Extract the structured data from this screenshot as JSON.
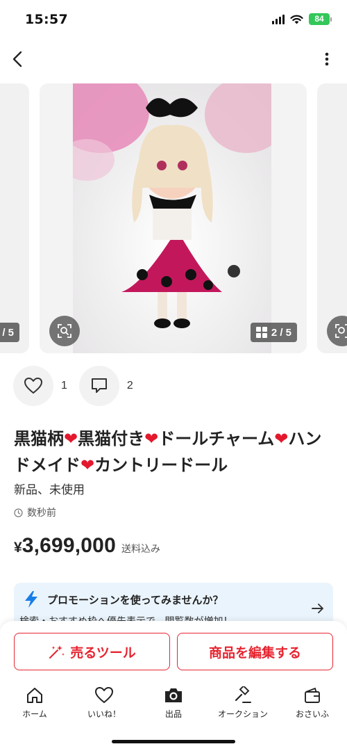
{
  "status_bar": {
    "time": "15:57",
    "battery": "84",
    "icons": [
      "cellular-signal-icon",
      "wifi-icon",
      "battery-icon"
    ]
  },
  "nav": {
    "back_icon": "chevron-left-icon",
    "more_icon": "vertical-ellipsis-icon"
  },
  "carousel": {
    "prev_counter": "/ 5",
    "current_counter": "2 / 5",
    "zoom_icon": "zoom-scan-icon",
    "grid_icon": "grid-icon"
  },
  "reactions": {
    "like_count": "1",
    "comment_count": "2"
  },
  "item": {
    "title_parts": [
      "黒猫柄",
      "❤",
      "黒猫付き",
      "❤",
      "ドールチャーム",
      "❤",
      "ハンドメイド",
      "❤",
      "カントリードール"
    ],
    "condition": "新品、未使用",
    "timestamp": "数秒前",
    "price_symbol": "¥",
    "price": "3,699,000",
    "shipping": "送料込み"
  },
  "promo": {
    "title": "プロモーションを使ってみませんか？",
    "subtitle": "検索・おすすめ枠へ優先表示で、閲覧数が増加！"
  },
  "actions": {
    "sell_tools": "売るツール",
    "edit_item": "商品を編集する"
  },
  "tabs": [
    {
      "label": "ホーム",
      "icon": "home-icon"
    },
    {
      "label": "いいね！",
      "icon": "heart-icon"
    },
    {
      "label": "出品",
      "icon": "camera-icon"
    },
    {
      "label": "オークション",
      "icon": "gavel-icon"
    },
    {
      "label": "おさいふ",
      "icon": "wallet-icon"
    }
  ],
  "colors": {
    "accent": "#e6242f",
    "heart": "#e3182d",
    "promo_bg": "#eaf4fc",
    "bolt": "#1a7ee8",
    "battery": "#34c759"
  }
}
